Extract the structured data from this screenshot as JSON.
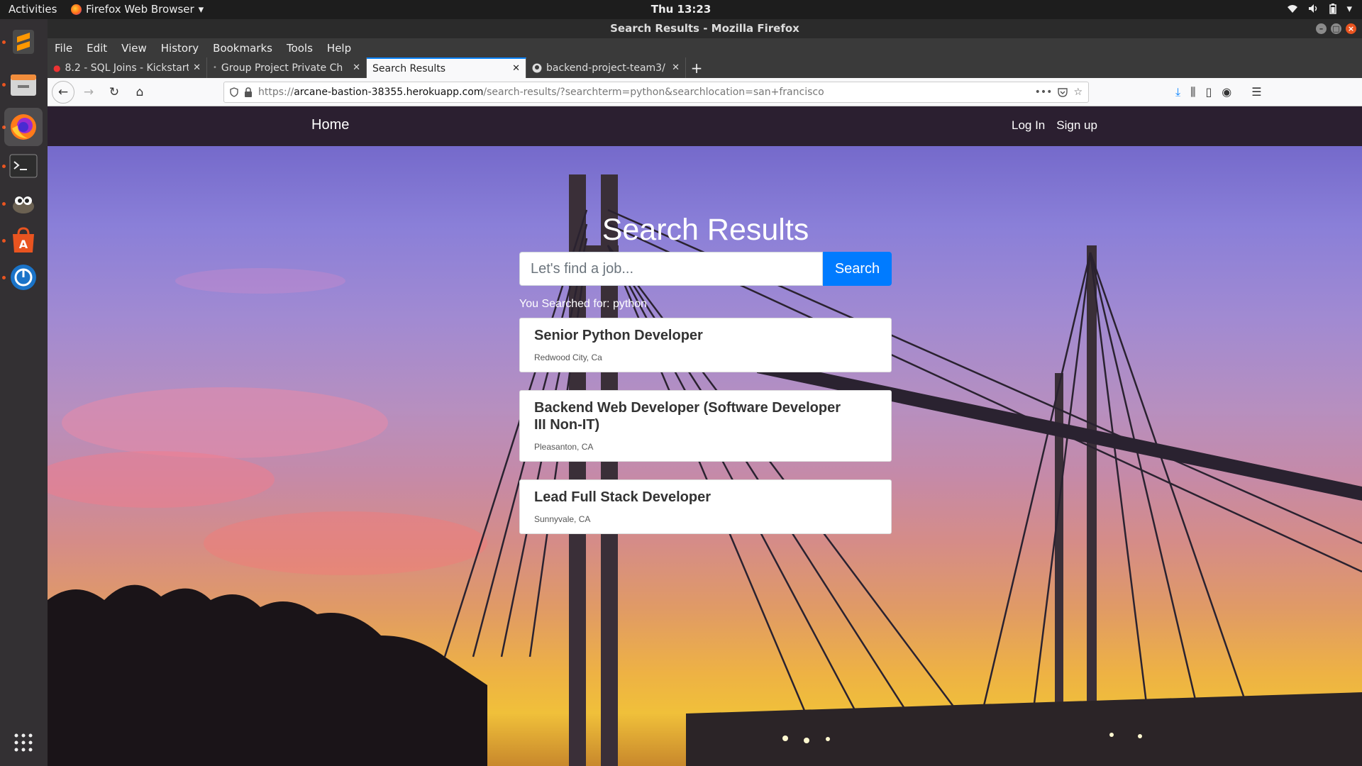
{
  "topbar": {
    "activities": "Activities",
    "app_name": "Firefox Web Browser",
    "clock": "Thu 13:23"
  },
  "window": {
    "title": "Search Results - Mozilla Firefox"
  },
  "menu": [
    "File",
    "Edit",
    "View",
    "History",
    "Bookmarks",
    "Tools",
    "Help"
  ],
  "tabs": [
    {
      "label": "8.2 - SQL Joins - Kickstart",
      "active": false
    },
    {
      "label": "Group Project Private Ch",
      "active": false
    },
    {
      "label": "Search Results",
      "active": true
    },
    {
      "label": "backend-project-team3/",
      "active": false
    }
  ],
  "address": {
    "scheme": "https://",
    "host": "arcane-bastion-38355.herokuapp.com",
    "path": "/search-results/?searchterm=python&searchlocation=san+francisco"
  },
  "site": {
    "home": "Home",
    "login": "Log In",
    "signup": "Sign up",
    "title": "Search Results",
    "search_placeholder": "Let's find a job...",
    "search_button": "Search",
    "searched_for": "You Searched for: python"
  },
  "results": [
    {
      "title": "Senior Python Developer",
      "location": "Redwood City, Ca"
    },
    {
      "title": "Backend Web Developer (Software Developer III Non-IT)",
      "location": "Pleasanton, CA"
    },
    {
      "title": "Lead Full Stack Developer",
      "location": "Sunnyvale, CA"
    }
  ],
  "colors": {
    "accent": "#007bff",
    "site_nav": "#2b1f30",
    "ubuntu_orange": "#e95420"
  }
}
